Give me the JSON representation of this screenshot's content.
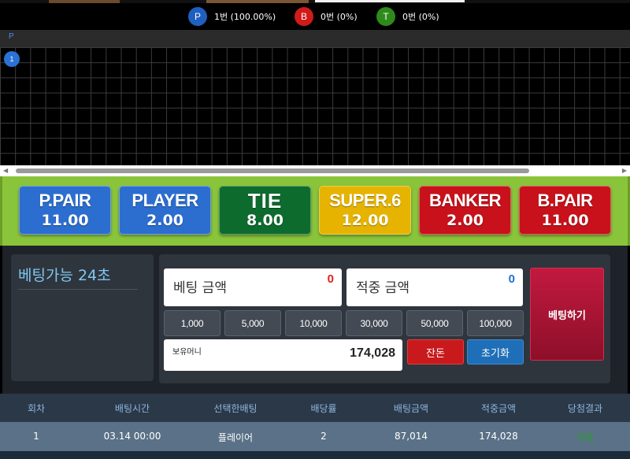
{
  "stats": {
    "player": {
      "letter": "P",
      "text": "1번 (100.00%)"
    },
    "banker": {
      "letter": "B",
      "text": "0번 (0%)"
    },
    "tie": {
      "letter": "T",
      "text": "0번 (0%)"
    }
  },
  "roadmap": {
    "header_label": "P",
    "beads": [
      {
        "label": "1",
        "result": "player"
      }
    ]
  },
  "boards": [
    {
      "name": "P.PAIR",
      "odds": "11.00",
      "color": "#2b6ed0"
    },
    {
      "name": "PLAYER",
      "odds": "2.00",
      "color": "#2b6ed0"
    },
    {
      "name": "TIE",
      "odds": "8.00",
      "color": "#0d6b2e"
    },
    {
      "name": "SUPER.6",
      "odds": "12.00",
      "color": "#e6b400"
    },
    {
      "name": "BANKER",
      "odds": "2.00",
      "color": "#c8111a"
    },
    {
      "name": "B.PAIR",
      "odds": "11.00",
      "color": "#c8111a"
    }
  ],
  "panel": {
    "timer_text": "베팅가능 24초",
    "bet_amount": {
      "label": "베팅 금액",
      "value": "0",
      "color": "#e02020"
    },
    "win_amount": {
      "label": "적중 금액",
      "value": "0",
      "color": "#1f6fd6"
    },
    "chips": [
      "1,000",
      "5,000",
      "10,000",
      "30,000",
      "50,000",
      "100,000"
    ],
    "cash": {
      "label": "보유머니",
      "value": "174,028"
    },
    "change_label": "잔돈",
    "reset_label": "초기화",
    "bet_label": "베팅하기"
  },
  "table": {
    "headers": [
      "회차",
      "배팅시간",
      "선택한배팅",
      "배당률",
      "배팅금액",
      "적중금액",
      "당첨결과"
    ],
    "rows": [
      [
        "1",
        "03.14 00:00",
        "플레이어",
        "2",
        "87,014",
        "174,028",
        "적중"
      ]
    ]
  }
}
